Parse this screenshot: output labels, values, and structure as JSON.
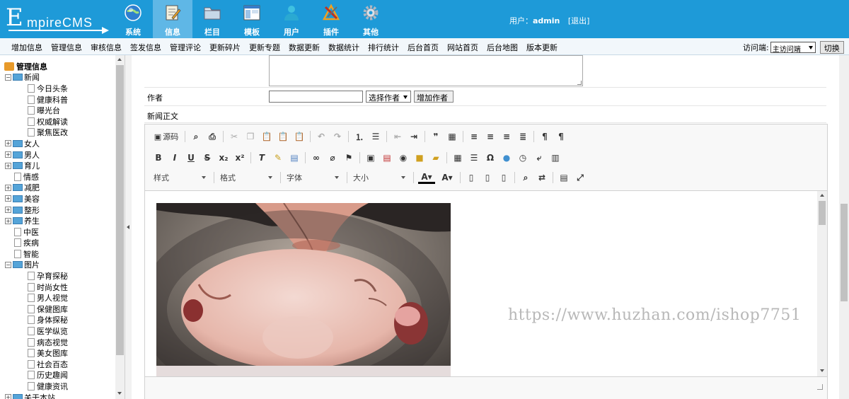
{
  "brand": {
    "big_letter": "E",
    "rest": "mpireCMS"
  },
  "main_nav": [
    {
      "label": "系统",
      "icon": "globe-icon"
    },
    {
      "label": "信息",
      "icon": "edit-document-icon",
      "active": true
    },
    {
      "label": "栏目",
      "icon": "folder-icon"
    },
    {
      "label": "模板",
      "icon": "window-template-icon"
    },
    {
      "label": "用户",
      "icon": "user-icon"
    },
    {
      "label": "插件",
      "icon": "tools-icon"
    },
    {
      "label": "其他",
      "icon": "gear-icon"
    }
  ],
  "user": {
    "prefix": "用户：",
    "name": "admin",
    "logout": "[退出]"
  },
  "sub_nav": [
    "增加信息",
    "管理信息",
    "审核信息",
    "签发信息",
    "管理评论",
    "更新碎片",
    "更新专题",
    "数据更新",
    "数据统计",
    "排行统计",
    "后台首页",
    "网站首页",
    "后台地图",
    "版本更新"
  ],
  "visit": {
    "label": "访问端:",
    "selected": "主访问端",
    "button": "切换"
  },
  "sidebar": {
    "root": "管理信息",
    "tree": [
      {
        "label": "新闻",
        "type": "folder",
        "expanded": true,
        "children": [
          "今日头条",
          "健康科普",
          "曝光台",
          "权威解读",
          "聚焦医改"
        ]
      },
      {
        "label": "女人",
        "type": "folder"
      },
      {
        "label": "男人",
        "type": "folder"
      },
      {
        "label": "育儿",
        "type": "folder"
      },
      {
        "label": "情感",
        "type": "doc"
      },
      {
        "label": "减肥",
        "type": "folder"
      },
      {
        "label": "美容",
        "type": "folder"
      },
      {
        "label": "整形",
        "type": "folder"
      },
      {
        "label": "养生",
        "type": "folder"
      },
      {
        "label": "中医",
        "type": "doc"
      },
      {
        "label": "疾病",
        "type": "doc"
      },
      {
        "label": "智能",
        "type": "doc"
      },
      {
        "label": "图片",
        "type": "folder",
        "expanded": true,
        "children": [
          "孕育探秘",
          "时尚女性",
          "男人视觉",
          "保健图库",
          "身体探秘",
          "医学纵览",
          "病态视觉",
          "美女图库",
          "社会百态",
          "历史趣闻",
          "健康资讯"
        ]
      },
      {
        "label": "关于本站",
        "type": "folder"
      }
    ]
  },
  "form": {
    "author_label": "作者",
    "author_select": "选择作者",
    "author_add_button": "增加作者",
    "body_label": "新闻正文"
  },
  "editor": {
    "source_label": "源码",
    "combos": [
      "样式",
      "格式",
      "字体",
      "大小"
    ]
  },
  "watermark": "https://www.huzhan.com/ishop7751"
}
